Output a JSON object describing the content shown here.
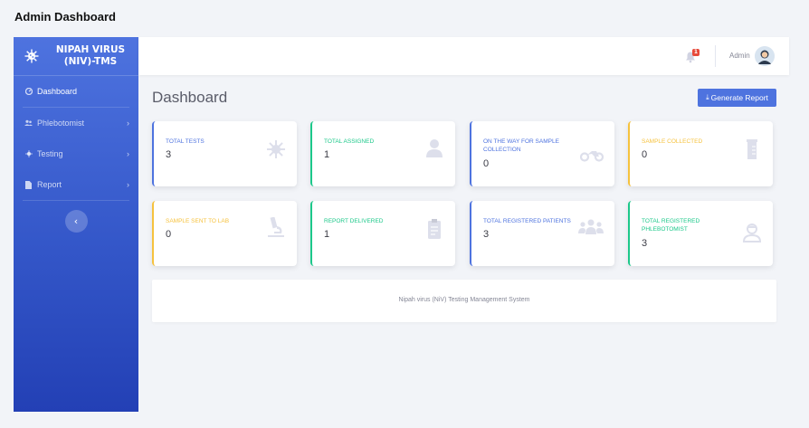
{
  "page": {
    "heading": "Admin Dashboard"
  },
  "sidebar": {
    "brand_line1": "NIPAH VIRUS",
    "brand_line2": "(NIV)-TMS",
    "items": [
      {
        "label": "Dashboard",
        "icon": "dashboard-icon",
        "has_chevron": false,
        "active": true
      },
      {
        "label": "Phlebotomist",
        "icon": "users-icon",
        "has_chevron": true
      },
      {
        "label": "Testing",
        "icon": "virus-icon",
        "has_chevron": true
      },
      {
        "label": "Report",
        "icon": "file-icon",
        "has_chevron": true
      }
    ],
    "toggle_glyph": "‹"
  },
  "topbar": {
    "notification_count": "1",
    "user_name": "Admin"
  },
  "main": {
    "title": "Dashboard",
    "generate_button": "Generate Report",
    "generate_icon": "⤓"
  },
  "cards": [
    {
      "title": "TOTAL TESTS",
      "value": "3",
      "color": "#4e73df",
      "icon": "virus-icon"
    },
    {
      "title": "TOTAL ASSIGNED",
      "value": "1",
      "color": "#1cc88a",
      "icon": "user-icon"
    },
    {
      "title": "ON THE WAY FOR SAMPLE COLLECTION",
      "value": "0",
      "color": "#4e73df",
      "icon": "motorcycle-icon"
    },
    {
      "title": "SAMPLE COLLECTED",
      "value": "0",
      "color": "#f6c23e",
      "icon": "vial-icon"
    },
    {
      "title": "SAMPLE SENT TO LAB",
      "value": "0",
      "color": "#f6c23e",
      "icon": "microscope-icon"
    },
    {
      "title": "REPORT DELIVERED",
      "value": "1",
      "color": "#1cc88a",
      "icon": "clipboard-icon"
    },
    {
      "title": "TOTAL REGISTERED PATIENTS",
      "value": "3",
      "color": "#4e73df",
      "icon": "group-icon"
    },
    {
      "title": "TOTAL REGISTERED PHLEBOTOMIST",
      "value": "3",
      "color": "#1cc88a",
      "icon": "doctor-icon"
    }
  ],
  "footer": {
    "text": "Nipah virus (NiV) Testing Management System"
  }
}
